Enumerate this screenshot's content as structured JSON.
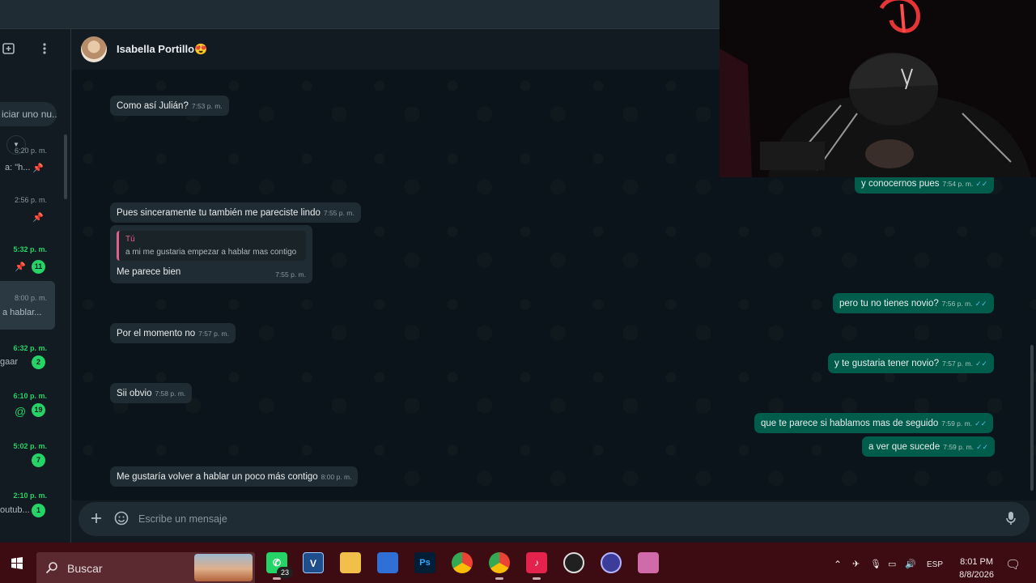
{
  "colors": {
    "accent": "#25d366",
    "incoming": "#202c33",
    "outgoing": "#005c4b",
    "read_ticks": "#53bdeb",
    "quote_accent": "#e15f8b",
    "taskbar": "#3d0c12"
  },
  "sidebar": {
    "search_partial": "iciar uno nu...",
    "chats": [
      {
        "time": "6:20 p. m.",
        "preview": "a: \"h...",
        "unread": false,
        "pinned": true
      },
      {
        "time": "2:56 p. m.",
        "preview": "",
        "unread": false,
        "pinned": true
      },
      {
        "time": "5:32 p. m.",
        "preview": "",
        "unread": true,
        "pinned": true,
        "badge": "11"
      },
      {
        "time": "8:00 p. m.",
        "preview": "a hablar...",
        "unread": false,
        "active": true
      },
      {
        "time": "6:32 p. m.",
        "preview": "gaar",
        "unread": true,
        "badge": "2"
      },
      {
        "time": "6:10 p. m.",
        "preview": "@",
        "unread": true,
        "badge": "19"
      },
      {
        "time": "5:02 p. m.",
        "preview": "",
        "unread": true,
        "badge": "7"
      },
      {
        "time": "2:10 p. m.",
        "preview": "outub...",
        "unread": true,
        "badge": "1"
      }
    ]
  },
  "header": {
    "contact_name": "Isabella Portillo😍"
  },
  "messages": [
    {
      "dir": "in",
      "text": "Como así Julián?",
      "time": "7:53 p. m."
    },
    {
      "dir": "out",
      "text": "y conocernos pues",
      "time": "7:54 p. m."
    },
    {
      "dir": "in",
      "text": "Pues sinceramente tu también me pareciste lindo",
      "time": "7:55 p. m."
    },
    {
      "dir": "in",
      "text": "Me parece bien",
      "time": "7:55 p. m.",
      "quote_author": "Tú",
      "quote_text": "a mi me gustaria empezar a hablar mas contigo"
    },
    {
      "dir": "out",
      "text": "pero tu no tienes novio?",
      "time": "7:56 p. m."
    },
    {
      "dir": "in",
      "text": "Por el momento no",
      "time": "7:57 p. m."
    },
    {
      "dir": "out",
      "text": "y te gustaria tener novio?",
      "time": "7:57 p. m."
    },
    {
      "dir": "in",
      "text": "Sii obvio",
      "time": "7:58 p. m."
    },
    {
      "dir": "out",
      "text": "que te parece si hablamos mas de seguido",
      "time": "7:59 p. m."
    },
    {
      "dir": "out",
      "text": "a ver que sucede",
      "time": "7:59 p. m."
    },
    {
      "dir": "in",
      "text": "Me gustaría volver a hablar un poco más contigo",
      "time": "8:00 p. m."
    }
  ],
  "composer": {
    "placeholder": "Escribe un mensaje"
  },
  "taskbar": {
    "search_label": "Buscar",
    "whatsapp_badge": "23",
    "language": "ESP",
    "time": "8:01 PM",
    "date": "8/8/2026"
  },
  "icons": {
    "new_chat": "new-chat-icon",
    "menu": "menu-dots-icon",
    "attach": "plus-icon",
    "sticker": "sticker-icon",
    "mic": "mic-icon",
    "read": "double-check-icon"
  }
}
